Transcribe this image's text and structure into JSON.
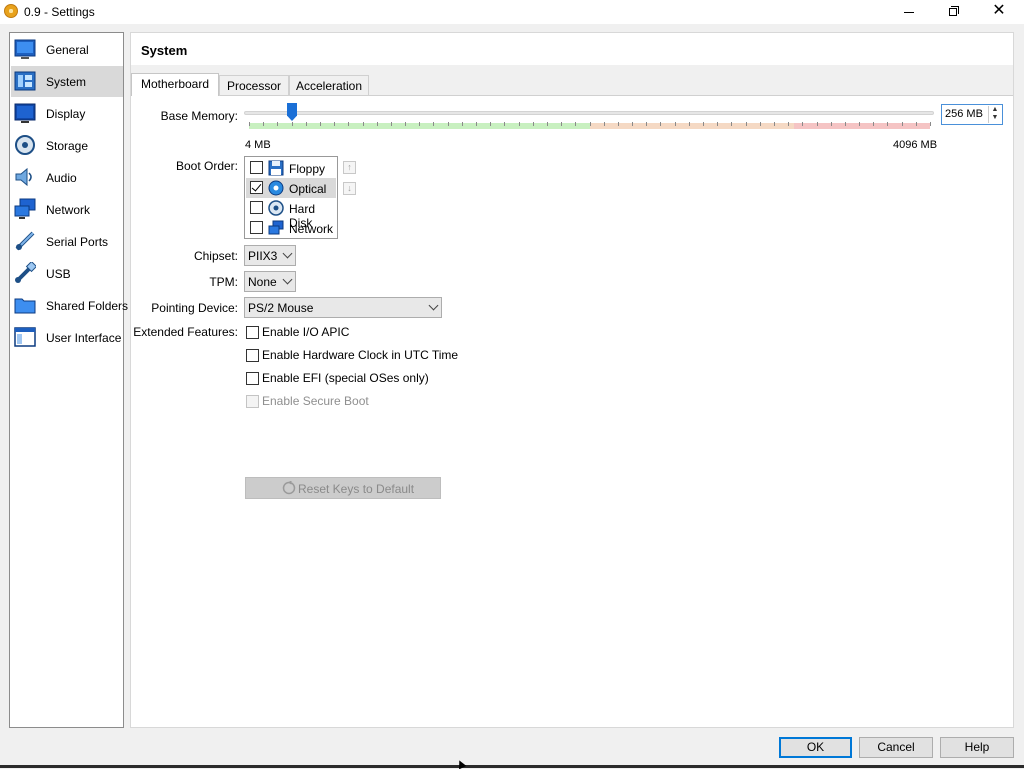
{
  "window": {
    "title": "0.9 - Settings",
    "controls": [
      "minimize",
      "restore",
      "close"
    ]
  },
  "sidebar": {
    "selected": "System",
    "items": [
      {
        "label": "General",
        "icon": "general-icon"
      },
      {
        "label": "System",
        "icon": "system-icon"
      },
      {
        "label": "Display",
        "icon": "display-icon"
      },
      {
        "label": "Storage",
        "icon": "storage-icon"
      },
      {
        "label": "Audio",
        "icon": "audio-icon"
      },
      {
        "label": "Network",
        "icon": "network-icon"
      },
      {
        "label": "Serial Ports",
        "icon": "serial-ports-icon"
      },
      {
        "label": "USB",
        "icon": "usb-icon"
      },
      {
        "label": "Shared Folders",
        "icon": "shared-folders-icon"
      },
      {
        "label": "User Interface",
        "icon": "user-interface-icon"
      }
    ]
  },
  "page": {
    "title": "System",
    "tabs": [
      {
        "label": "Motherboard",
        "active": true
      },
      {
        "label": "Processor",
        "active": false
      },
      {
        "label": "Acceleration",
        "active": false
      }
    ]
  },
  "motherboard": {
    "base_memory": {
      "label": "Base Memory:",
      "value": "256 MB",
      "value_mb": 256,
      "min_label": "4 MB",
      "max_label": "4096 MB",
      "min_mb": 4,
      "max_mb": 4096,
      "scale_colors": {
        "ok": "#c8f0c0",
        "warn": "#f5d9c4",
        "bad": "#f5c4c4"
      }
    },
    "boot_order": {
      "label": "Boot Order:",
      "items": [
        {
          "label": "Floppy",
          "checked": false,
          "selected": false,
          "icon": "floppy-icon"
        },
        {
          "label": "Optical",
          "checked": true,
          "selected": true,
          "icon": "optical-disc-icon"
        },
        {
          "label": "Hard Disk",
          "checked": false,
          "selected": false,
          "icon": "hard-disk-icon"
        },
        {
          "label": "Network",
          "checked": false,
          "selected": false,
          "icon": "network-boot-icon"
        }
      ]
    },
    "chipset": {
      "label": "Chipset:",
      "value": "PIIX3"
    },
    "tpm": {
      "label": "TPM:",
      "value": "None"
    },
    "pointing_device": {
      "label": "Pointing Device:",
      "value": "PS/2 Mouse"
    },
    "extended_features": {
      "label": "Extended Features:",
      "options": [
        {
          "label": "Enable I/O APIC",
          "checked": false,
          "enabled": true
        },
        {
          "label": "Enable Hardware Clock in UTC Time",
          "checked": false,
          "enabled": true
        },
        {
          "label": "Enable EFI (special OSes only)",
          "checked": false,
          "enabled": true
        },
        {
          "label": "Enable Secure Boot",
          "checked": false,
          "enabled": false
        }
      ]
    },
    "reset_keys_label": "Reset Keys to Default"
  },
  "buttons": {
    "ok": "OK",
    "cancel": "Cancel",
    "help": "Help"
  },
  "colors": {
    "accent": "#0078d7",
    "slider_thumb": "#1a6fd6",
    "selection": "#d9d9d9"
  }
}
